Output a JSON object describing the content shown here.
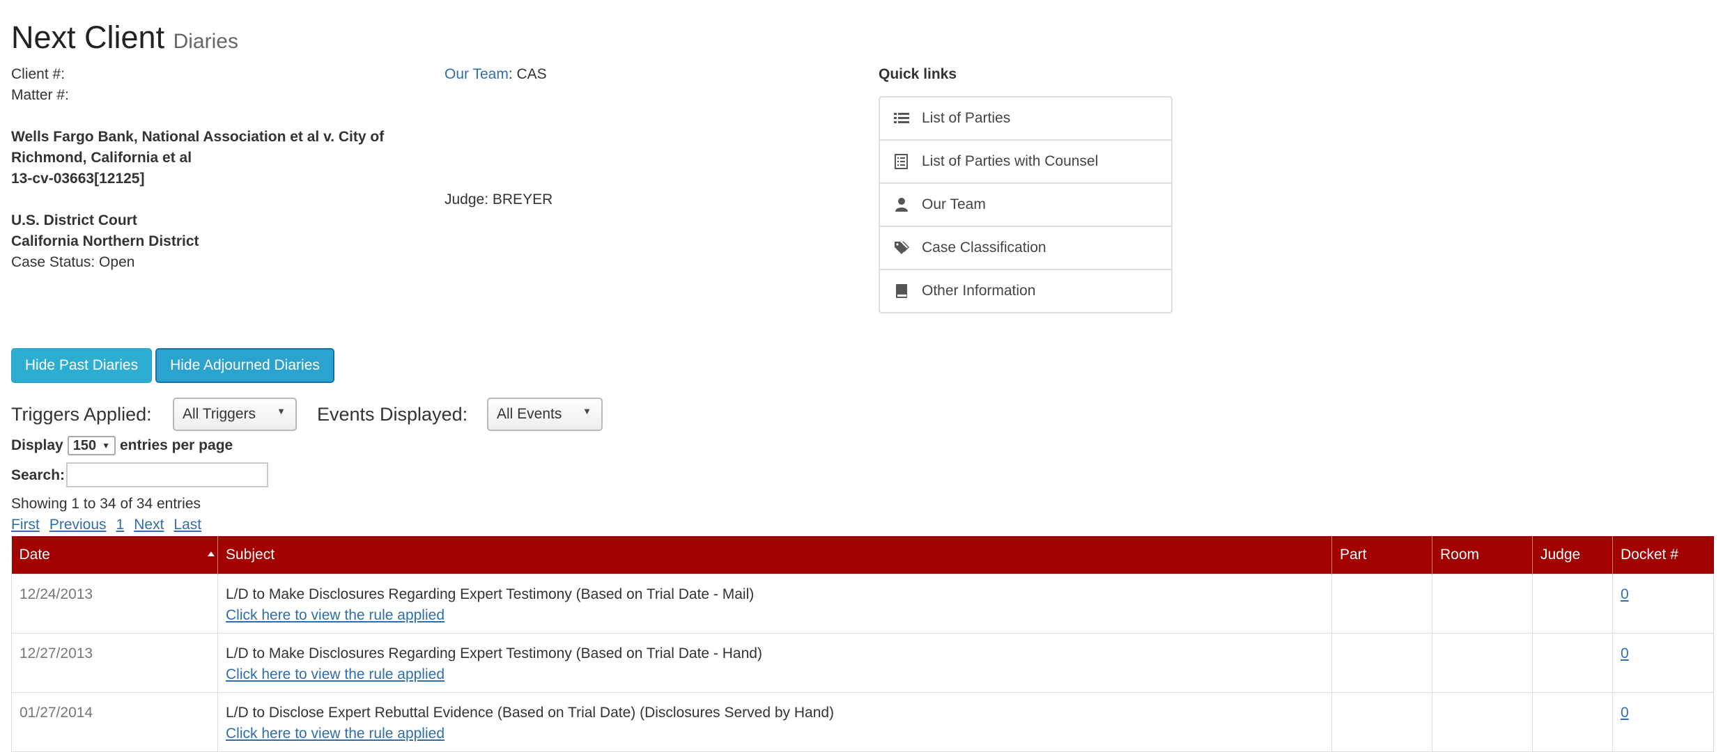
{
  "header": {
    "title": "Next Client",
    "subtitle": "Diaries"
  },
  "case_info": {
    "client_label": "Client #:",
    "matter_label": "Matter #:",
    "case_name_line1": "Wells Fargo Bank, National Association et al v. City of",
    "case_name_line2": "Richmond, California et al",
    "case_number": "13-cv-03663[12125]",
    "court_line1": "U.S. District Court",
    "court_line2": "California Northern District",
    "status": "Case Status: Open",
    "team_label": "Our Team",
    "team_value": ": CAS",
    "judge": "Judge: BREYER"
  },
  "quick_links": {
    "title": "Quick links",
    "items": [
      {
        "label": "List of Parties",
        "icon": "list-icon"
      },
      {
        "label": "List of Parties with Counsel",
        "icon": "document-list-icon"
      },
      {
        "label": "Our Team",
        "icon": "user-icon"
      },
      {
        "label": "Case Classification",
        "icon": "tags-icon"
      },
      {
        "label": "Other Information",
        "icon": "book-icon"
      }
    ]
  },
  "buttons": {
    "hide_past": "Hide Past Diaries",
    "hide_adjourned": "Hide Adjourned Diaries"
  },
  "filters": {
    "triggers_label": "Triggers Applied:",
    "triggers_value": "All Triggers",
    "events_label": "Events Displayed:",
    "events_value": "All Events"
  },
  "paging": {
    "display_label": "Display",
    "entries_value": "150",
    "entries_suffix": "entries per page",
    "search_label": "Search:",
    "search_value": "",
    "showing": "Showing 1 to 34 of 34 entries",
    "first": "First",
    "previous": "Previous",
    "page": "1",
    "next": "Next",
    "last": "Last"
  },
  "table": {
    "columns": [
      "Date",
      "Subject",
      "Part",
      "Room",
      "Judge",
      "Docket #"
    ],
    "rule_link": "Click here to view the rule applied",
    "rows": [
      {
        "date": "12/24/2013",
        "subject": "L/D to Make Disclosures Regarding Expert Testimony (Based on Trial Date - Mail)",
        "part": "",
        "room": "",
        "judge": "",
        "docket": "0"
      },
      {
        "date": "12/27/2013",
        "subject": "L/D to Make Disclosures Regarding Expert Testimony (Based on Trial Date - Hand)",
        "part": "",
        "room": "",
        "judge": "",
        "docket": "0"
      },
      {
        "date": "01/27/2014",
        "subject": "L/D to Disclose Expert Rebuttal Evidence (Based on Trial Date) (Disclosures Served by Hand)",
        "part": "",
        "room": "",
        "judge": "",
        "docket": "0"
      }
    ]
  },
  "colors": {
    "header_red": "#a30000",
    "button_blue": "#2eadd3",
    "link_blue": "#2f6ea8"
  }
}
